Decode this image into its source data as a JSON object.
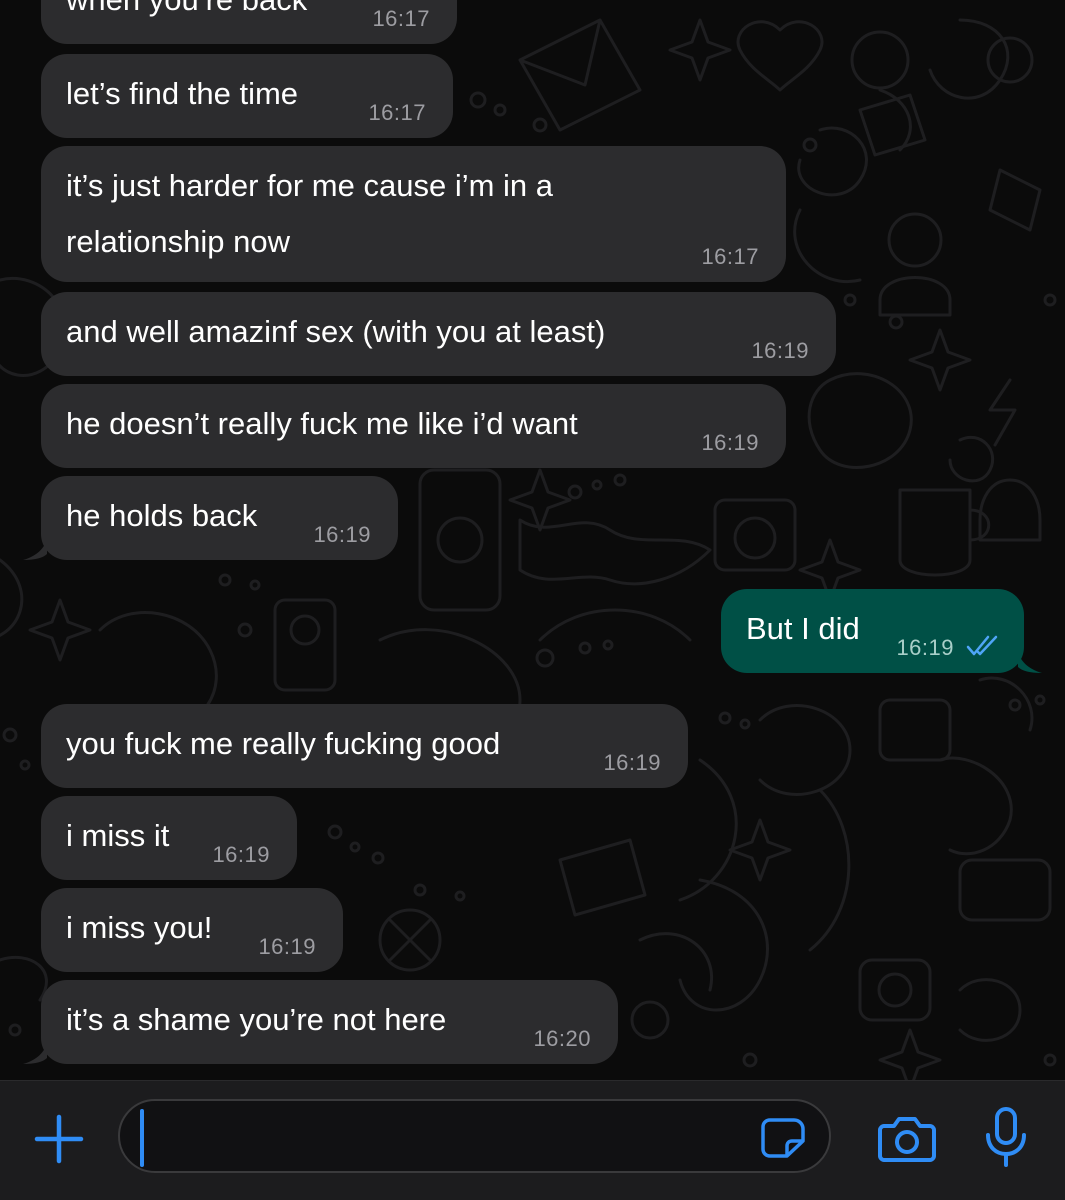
{
  "messages": [
    {
      "direction": "in",
      "text": "when you’re back",
      "time": "16:17"
    },
    {
      "direction": "in",
      "text": "let’s find the time",
      "time": "16:17"
    },
    {
      "direction": "in",
      "text": "it’s just harder for me cause i’m in a relationship now",
      "time": "16:17"
    },
    {
      "direction": "in",
      "text": "and well amazinf sex (with you at least)",
      "time": "16:19"
    },
    {
      "direction": "in",
      "text": "he doesn’t really fuck me like i’d want",
      "time": "16:19"
    },
    {
      "direction": "in",
      "text": "he holds back",
      "time": "16:19"
    },
    {
      "direction": "out",
      "text": "But I did",
      "time": "16:19",
      "status": "read"
    },
    {
      "direction": "in",
      "text": "you fuck me really fucking good",
      "time": "16:19"
    },
    {
      "direction": "in",
      "text": "i miss it",
      "time": "16:19"
    },
    {
      "direction": "in",
      "text": "i miss you!",
      "time": "16:19"
    },
    {
      "direction": "in",
      "text": "it’s a shame you’re not here",
      "time": "16:20"
    }
  ],
  "input": {
    "value": "",
    "icons": {
      "left": "plus-icon",
      "inside": "sticker-icon",
      "right1": "camera-icon",
      "right2": "microphone-icon"
    }
  },
  "colors": {
    "incoming_bubble": "#2c2c2e",
    "outgoing_bubble": "#005046",
    "accent": "#2f8cf5",
    "background": "#0b0b0b",
    "read_ticks": "#4fa5f7"
  }
}
